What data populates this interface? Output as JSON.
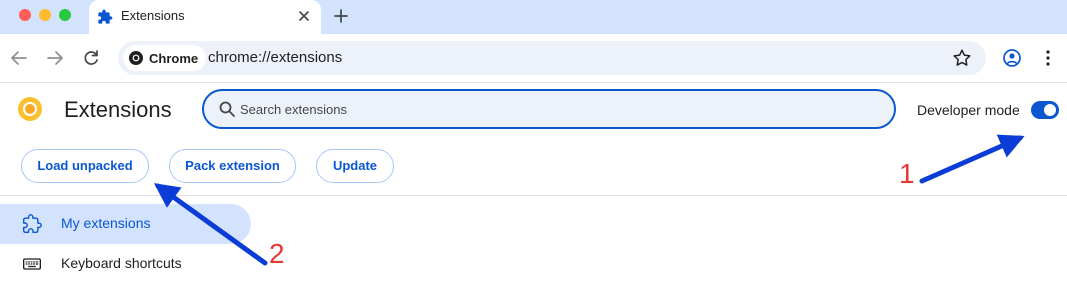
{
  "browser": {
    "tab": {
      "title": "Extensions",
      "icon": "puzzle-icon"
    },
    "omnibox": {
      "chip_label": "Chrome",
      "url": "chrome://extensions"
    },
    "colors": {
      "tabbar": "#d3e3fd",
      "accent": "#0b57d0"
    }
  },
  "header": {
    "title": "Extensions",
    "search": {
      "placeholder": "Search extensions"
    },
    "developer_mode": {
      "label": "Developer mode",
      "enabled": true
    }
  },
  "actions": {
    "load_unpacked": "Load unpacked",
    "pack_extension": "Pack extension",
    "update": "Update"
  },
  "sidebar": {
    "items": [
      {
        "label": "My extensions",
        "icon": "puzzle-outline-icon",
        "active": true
      },
      {
        "label": "Keyboard shortcuts",
        "icon": "keyboard-icon",
        "active": false
      }
    ]
  },
  "annotations": [
    {
      "label": "1",
      "color": "#e53935"
    },
    {
      "label": "2",
      "color": "#e53935"
    }
  ]
}
